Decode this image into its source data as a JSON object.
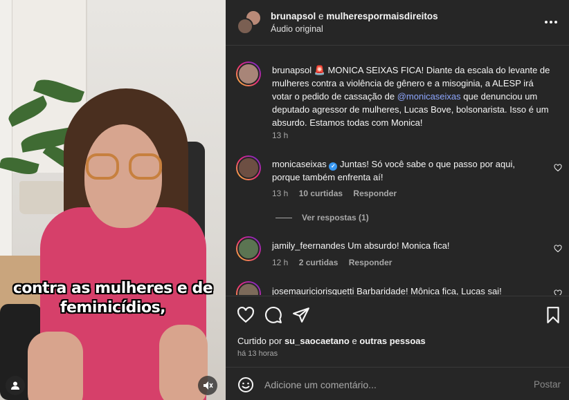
{
  "video": {
    "caption_line1": "contra as mulheres e de",
    "caption_line2": "feminicídios,",
    "icons": [
      "user-icon",
      "muted-icon"
    ]
  },
  "header": {
    "user1": "brunapsol",
    "conjunction": "e",
    "user2": "mulherespormaisdireitos",
    "subtitle": "Áudio original"
  },
  "caption": {
    "username": "brunapsol",
    "emoji": "🚨",
    "text_before_mention": "MONICA SEIXAS FICA! Diante da escala do levante de mulheres contra a violência de gênero e a misoginia, a ALESP irá votar o pedido de cassação de",
    "mention": "@monicaseixas",
    "text_after_mention": "que denunciou um deputado agressor de mulheres, Lucas Bove, bolsonarista. Isso é um absurdo. Estamos todas com Monica!",
    "time": "13 h"
  },
  "comments": [
    {
      "username": "monicaseixas",
      "verified": true,
      "text": "Juntas! Só você sabe o que passo por aqui, porque também enfrenta aí!",
      "time": "13 h",
      "likes": "10 curtidas",
      "reply": "Responder",
      "view_replies": "Ver respostas (1)"
    },
    {
      "username": "jamily_feernandes",
      "text": "Um absurdo! Monica fica!",
      "time": "12 h",
      "likes": "2 curtidas",
      "reply": "Responder"
    },
    {
      "username": "josemauriciorisquetti",
      "text": "Barbaridade! Mônica fica, Lucas sai!"
    }
  ],
  "actions": {
    "liked_prefix": "Curtido por",
    "liked_user": "su_saocaetano",
    "liked_and": "e",
    "liked_others": "outras pessoas",
    "time_ago": "há 13 horas"
  },
  "add_comment": {
    "placeholder": "Adicione um comentário...",
    "post_label": "Postar"
  },
  "colors": {
    "panel_bg": "#262626",
    "mention": "#8ea7ff",
    "verified": "#3897f0",
    "muted_text": "#a8a8a8"
  }
}
